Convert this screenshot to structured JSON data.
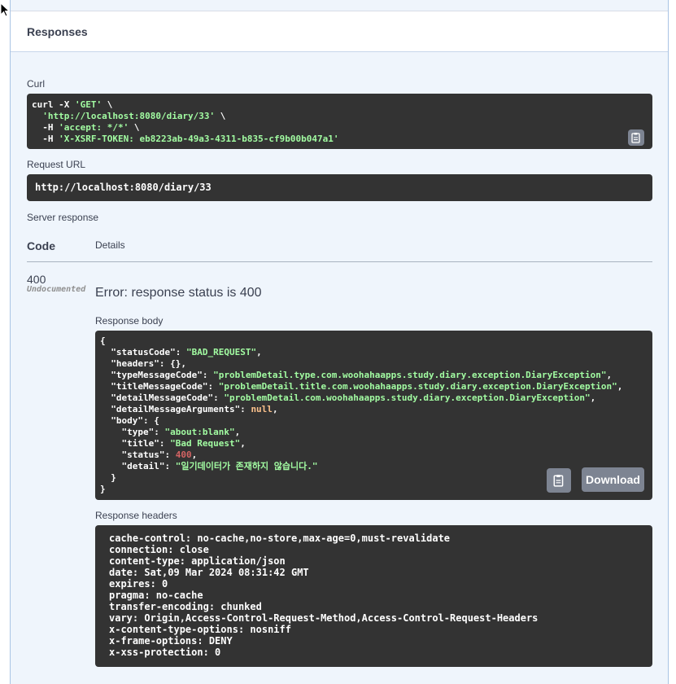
{
  "responses_title": "Responses",
  "curl": {
    "label": "Curl",
    "line1_cmd": "curl -X ",
    "line1_method": "'GET'",
    "line1_cont": " \\",
    "line2_url": "'http://localhost:8080/diary/33'",
    "line2_cont": " \\",
    "line3_flag": "-H ",
    "line3_val": "'accept: */*'",
    "line3_cont": " \\",
    "line4_flag": "-H ",
    "line4_val": "'X-XSRF-TOKEN: eb8223ab-49a3-4311-b835-cf9b00b047a1'"
  },
  "request_url": {
    "label": "Request URL",
    "value": "http://localhost:8080/diary/33"
  },
  "server_response": {
    "label": "Server response",
    "col_code": "Code",
    "col_details": "Details",
    "status_code": "400",
    "undocumented": "Undocumented",
    "error_text": "Error: response status is 400"
  },
  "response_body": {
    "label": "Response body",
    "download_label": "Download",
    "lines": [
      {
        "indent": "",
        "key": "",
        "value": "{",
        "type": "plain"
      },
      {
        "indent": "  ",
        "key": "\"statusCode\": ",
        "value": "\"BAD_REQUEST\"",
        "tail": ",",
        "type": "str"
      },
      {
        "indent": "  ",
        "key": "\"headers\": {},",
        "value": "",
        "tail": "",
        "type": "plain"
      },
      {
        "indent": "  ",
        "key": "\"typeMessageCode\": ",
        "value": "\"problemDetail.type.com.woohahaapps.study.diary.exception.DiaryException\"",
        "tail": ",",
        "type": "str"
      },
      {
        "indent": "  ",
        "key": "\"titleMessageCode\": ",
        "value": "\"problemDetail.title.com.woohahaapps.study.diary.exception.DiaryException\"",
        "tail": ",",
        "type": "str"
      },
      {
        "indent": "  ",
        "key": "\"detailMessageCode\": ",
        "value": "\"problemDetail.com.woohahaapps.study.diary.exception.DiaryException\"",
        "tail": ",",
        "type": "str"
      },
      {
        "indent": "  ",
        "key": "\"detailMessageArguments\": ",
        "value": "null",
        "tail": ",",
        "type": "null"
      },
      {
        "indent": "  ",
        "key": "\"body\": {",
        "value": "",
        "tail": "",
        "type": "plain"
      },
      {
        "indent": "    ",
        "key": "\"type\": ",
        "value": "\"about:blank\"",
        "tail": ",",
        "type": "str"
      },
      {
        "indent": "    ",
        "key": "\"title\": ",
        "value": "\"Bad Request\"",
        "tail": ",",
        "type": "str"
      },
      {
        "indent": "    ",
        "key": "\"status\": ",
        "value": "400",
        "tail": ",",
        "type": "num"
      },
      {
        "indent": "    ",
        "key": "\"detail\": ",
        "value": "\"일기데이터가 존재하지 않습니다.\"",
        "tail": "",
        "type": "str"
      },
      {
        "indent": "  ",
        "key": "}",
        "value": "",
        "tail": "",
        "type": "plain"
      },
      {
        "indent": "",
        "key": "}",
        "value": "",
        "tail": "",
        "type": "plain"
      }
    ]
  },
  "response_headers": {
    "label": "Response headers",
    "lines": [
      "cache-control: no-cache,no-store,max-age=0,must-revalidate",
      "connection: close",
      "content-type: application/json",
      "date: Sat,09 Mar 2024 08:31:42 GMT",
      "expires: 0",
      "pragma: no-cache",
      "transfer-encoding: chunked",
      "vary: Origin,Access-Control-Request-Method,Access-Control-Request-Headers",
      "x-content-type-options: nosniff",
      "x-frame-options: DENY",
      "x-xss-protection: 0"
    ]
  },
  "icons": {
    "copy": "clipboard-icon",
    "cursor": "mouse-cursor-icon"
  }
}
